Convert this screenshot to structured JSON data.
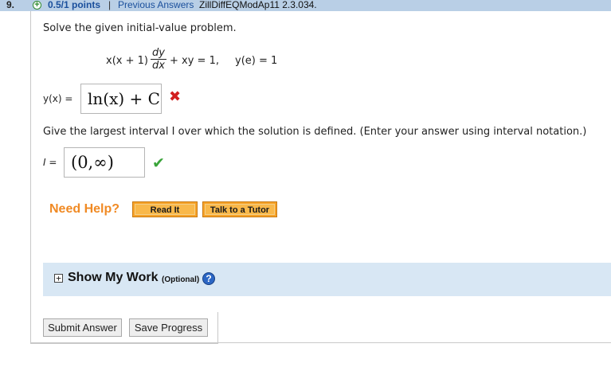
{
  "header": {
    "question_number": "9.",
    "status_icon": "plus-circle-icon",
    "points": "0.5/1 points",
    "separator": "|",
    "previous_answers": "Previous Answers",
    "question_id": "ZillDiffEQModAp11 2.3.034."
  },
  "problem": {
    "prompt": "Solve the given initial-value problem.",
    "equation": {
      "lhs": "x(x + 1)",
      "numerator": "dy",
      "denominator": "dx",
      "rhs": "+ xy = 1,",
      "condition": "y(e) = 1"
    }
  },
  "answer_y": {
    "label": "y(x) =",
    "value": "ln(x) + C",
    "result_icon": "cross-icon",
    "result_symbol": "✖"
  },
  "interval": {
    "prompt": "Give the largest interval I over which the solution is defined. (Enter your answer using interval notation.)",
    "label": "I =",
    "value": "(0,∞)",
    "result_icon": "check-icon",
    "result_symbol": "✔"
  },
  "help": {
    "title": "Need Help?",
    "read_it": "Read It",
    "talk_to_tutor": "Talk to a Tutor"
  },
  "show_my_work": {
    "toggle_symbol": "+",
    "title": "Show My Work",
    "optional": "(Optional)",
    "help_symbol": "?"
  },
  "actions": {
    "submit": "Submit Answer",
    "save": "Save Progress"
  },
  "colors": {
    "header_bg": "#b9cfe6",
    "link": "#1a4f9c",
    "incorrect": "#d21f1f",
    "correct": "#3aa43a",
    "help_orange": "#f7a227",
    "work_panel_bg": "#d8e7f4"
  }
}
